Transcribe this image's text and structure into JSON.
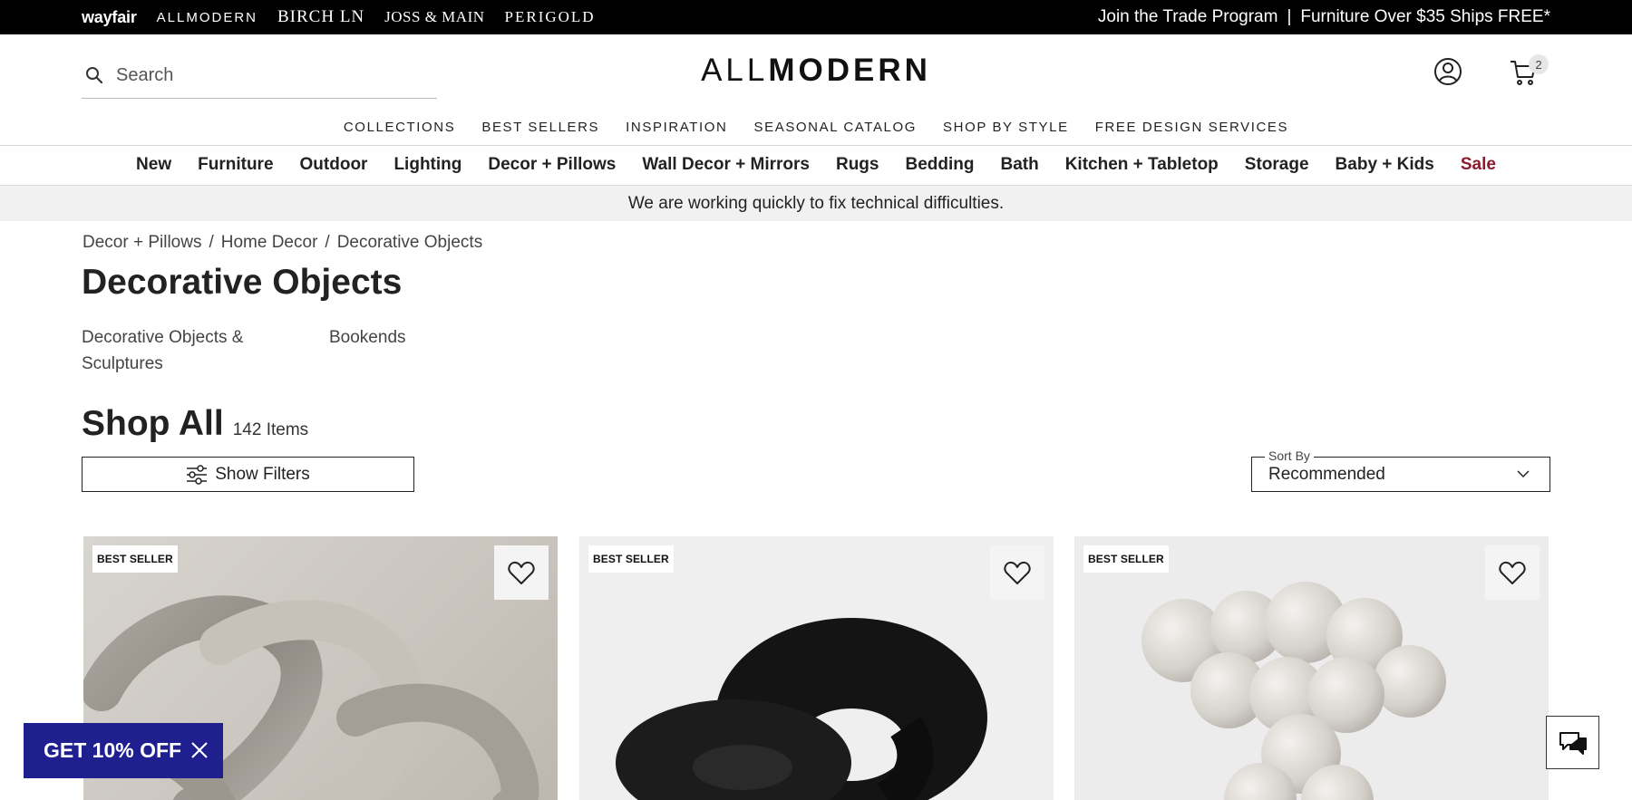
{
  "brandbar": {
    "brands": [
      "wayfair",
      "ALLMODERN",
      "BIRCH LN",
      "JOSS & MAIN",
      "PERIGOLD"
    ],
    "trade_link": "Join the Trade Program",
    "separator": "|",
    "shipping_promo": "Furniture Over $35 Ships FREE*"
  },
  "header": {
    "search_placeholder": "Search",
    "logo_light": "ALL",
    "logo_bold": "MODERN",
    "cart_count": "2"
  },
  "subnav": [
    "COLLECTIONS",
    "BEST SELLERS",
    "INSPIRATION",
    "SEASONAL CATALOG",
    "SHOP BY STYLE",
    "FREE DESIGN SERVICES"
  ],
  "catnav": [
    "New",
    "Furniture",
    "Outdoor",
    "Lighting",
    "Decor + Pillows",
    "Wall Decor + Mirrors",
    "Rugs",
    "Bedding",
    "Bath",
    "Kitchen + Tabletop",
    "Storage",
    "Baby + Kids",
    "Sale"
  ],
  "notice": "We are working quickly to fix technical difficulties.",
  "breadcrumb": [
    "Decor + Pillows",
    "Home Decor",
    "Decorative Objects"
  ],
  "breadcrumb_sep": "/",
  "page_title": "Decorative Objects",
  "subcategories": [
    "Decorative Objects & Sculptures",
    "Bookends"
  ],
  "shop_all": {
    "title": "Shop All",
    "count": "142 Items"
  },
  "filters_label": "Show Filters",
  "sort": {
    "label": "Sort By",
    "value": "Recommended"
  },
  "products": [
    {
      "badge": "BEST SELLER"
    },
    {
      "badge": "BEST SELLER"
    },
    {
      "badge": "BEST SELLER"
    }
  ],
  "offer": "GET 10% OFF",
  "colors": {
    "offer_bg": "#1f1f8f",
    "sale": "#8b1a2c",
    "notice_bg": "#f1f1f1"
  }
}
